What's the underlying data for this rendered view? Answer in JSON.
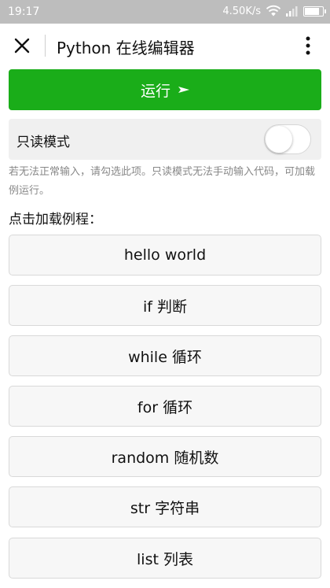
{
  "statusbar": {
    "time": "19:17",
    "network_speed": "4.50K/s",
    "icons": [
      "wifi-icon",
      "signal-icon",
      "battery-icon"
    ]
  },
  "titlebar": {
    "close_icon": "close-icon",
    "title": "Python 在线编辑器",
    "more_icon": "more-vertical-icon"
  },
  "run_button": {
    "label": "运行",
    "icon": "play-arrow-icon",
    "color": "#1aad19"
  },
  "readonly": {
    "label": "只读模式",
    "enabled": false
  },
  "hint": "若无法正常输入，请勾选此项。只读模式无法手动输入代码，可加载例运行。",
  "examples_title": "点击加载例程：",
  "examples": [
    {
      "label": "hello world"
    },
    {
      "label": "if 判断"
    },
    {
      "label": "while 循环"
    },
    {
      "label": "for 循环"
    },
    {
      "label": "random 随机数"
    },
    {
      "label": "str 字符串"
    },
    {
      "label": "list 列表"
    }
  ]
}
